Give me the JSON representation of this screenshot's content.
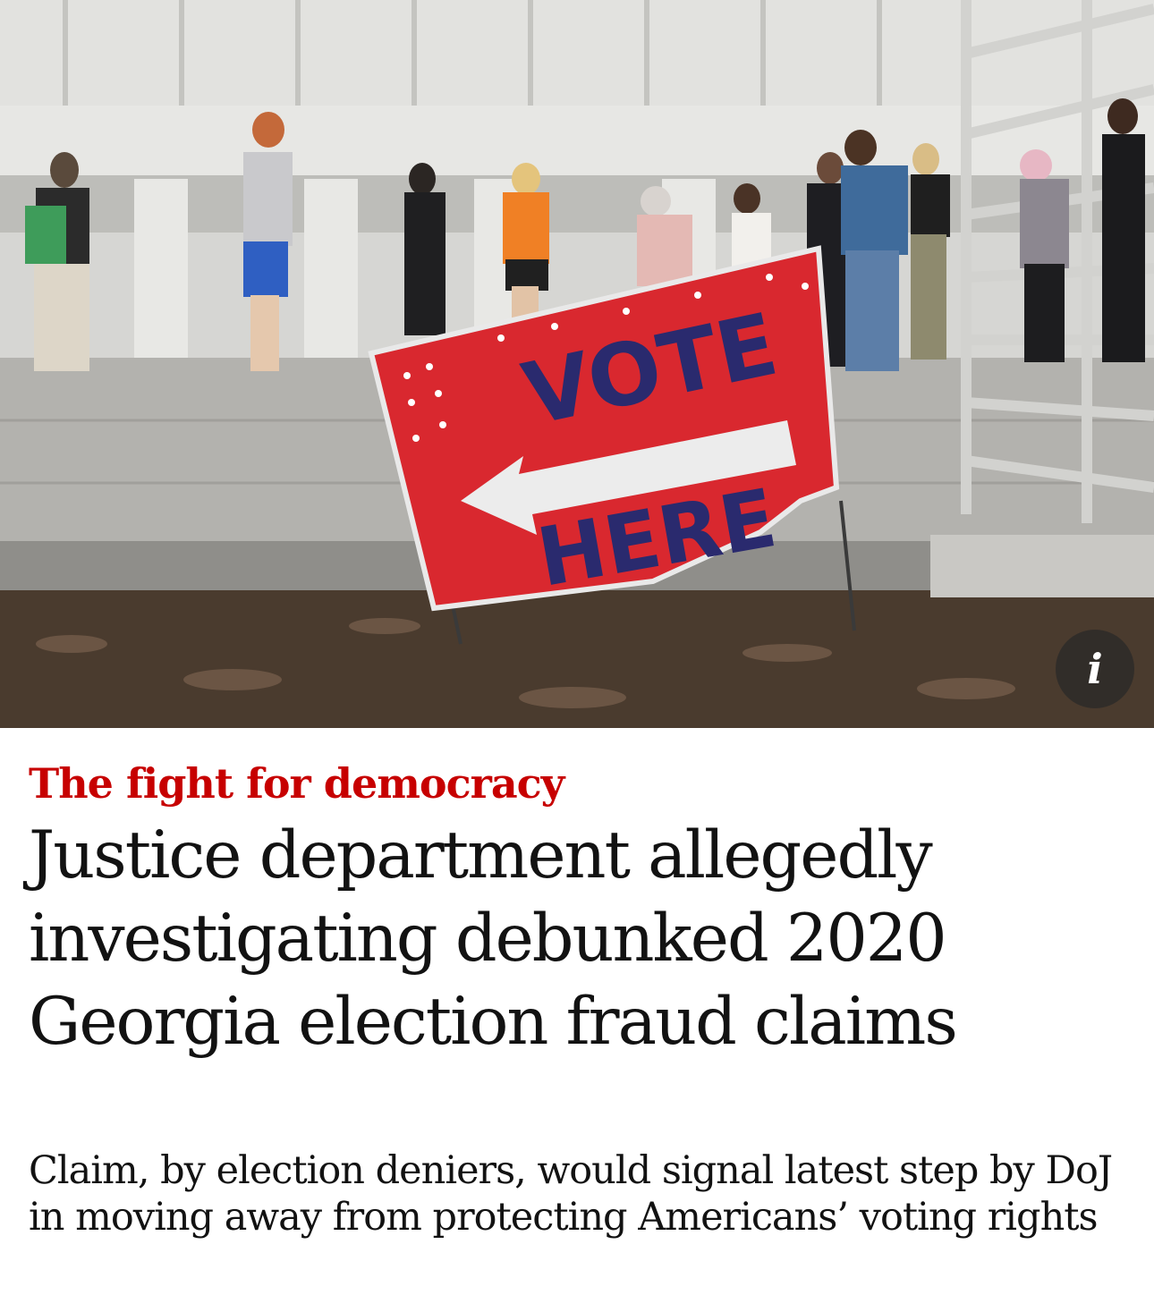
{
  "hero": {
    "sign_line1": "VOTE",
    "sign_line2": "HERE",
    "info_icon": "info-icon",
    "info_glyph": "i"
  },
  "article": {
    "kicker": "The fight for democracy",
    "headline": "Justice department allegedly investigating debunked 2020 Georgia election fraud claims",
    "standfirst": "Claim, by election deniers, would signal latest step by DoJ in moving away from protecting Americans’ voting rights"
  },
  "colors": {
    "kicker_red": "#c70000",
    "sign_red": "#d9282f",
    "sign_navy": "#2a2a6e",
    "text": "#121212"
  }
}
